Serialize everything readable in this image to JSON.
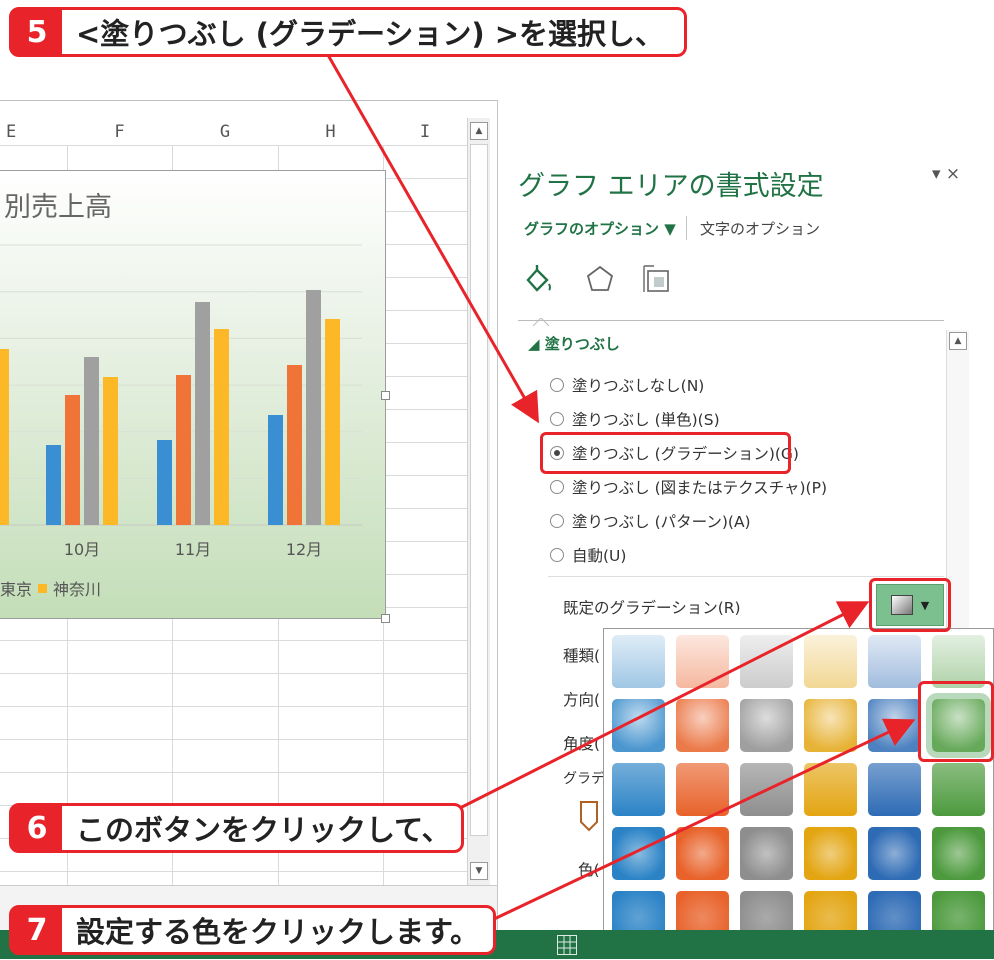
{
  "callouts": {
    "step5": {
      "num": "5",
      "text": "<塗りつぶし (グラデーション) >を選択し、"
    },
    "step6": {
      "num": "6",
      "text": "このボタンをクリックして、"
    },
    "step7": {
      "num": "7",
      "text": "設定する色をクリックします。"
    }
  },
  "sheet": {
    "columns": [
      "E",
      "F",
      "G",
      "H",
      "I"
    ]
  },
  "chart": {
    "title": "別売上高",
    "legend": [
      "東京",
      "神奈川"
    ],
    "colors": {
      "blue": "#3a8fd2",
      "orange": "#f07438",
      "gray": "#a0a0a0",
      "yellow": "#fdb827"
    }
  },
  "chart_data": {
    "type": "bar",
    "title": "別売上高",
    "categories": [
      "10月",
      "11月",
      "12月"
    ],
    "series": [
      {
        "values": [
          80,
          85,
          110
        ]
      },
      {
        "values": [
          130,
          150,
          160
        ]
      },
      {
        "values": [
          168,
          223,
          235
        ]
      },
      {
        "name": "神奈川",
        "values": [
          148,
          196,
          206
        ]
      }
    ],
    "legend": [
      "東京",
      "神奈川"
    ]
  },
  "pane": {
    "title": "グラフ エリアの書式設定",
    "tab_chart_options": "グラフのオプション ▼",
    "tab_text_options": "文字のオプション",
    "close": "▾ ×",
    "section_fill": "◢ 塗りつぶし",
    "fill_options": [
      {
        "label": "塗りつぶしなし(N)",
        "selected": false
      },
      {
        "label": "塗りつぶし (単色)(S)",
        "selected": false
      },
      {
        "label": "塗りつぶし (グラデーション)(G)",
        "selected": true
      },
      {
        "label": "塗りつぶし (図またはテクスチャ)(P)",
        "selected": false
      },
      {
        "label": "塗りつぶし (パターン)(A)",
        "selected": false
      },
      {
        "label": "自動(U)",
        "selected": false
      }
    ],
    "preset_gradient_label": "既定のグラデーション(R)",
    "type_label": "種類(",
    "direction_label": "方向(",
    "angle_label": "角度(",
    "gradient_stops_label": "グラデ",
    "color_label": "色("
  },
  "palette": {
    "colors": [
      "#2b83c6",
      "#e8622a",
      "#8e8e8e",
      "#e3a512",
      "#2e6bb5",
      "#4c9a3d"
    ]
  }
}
